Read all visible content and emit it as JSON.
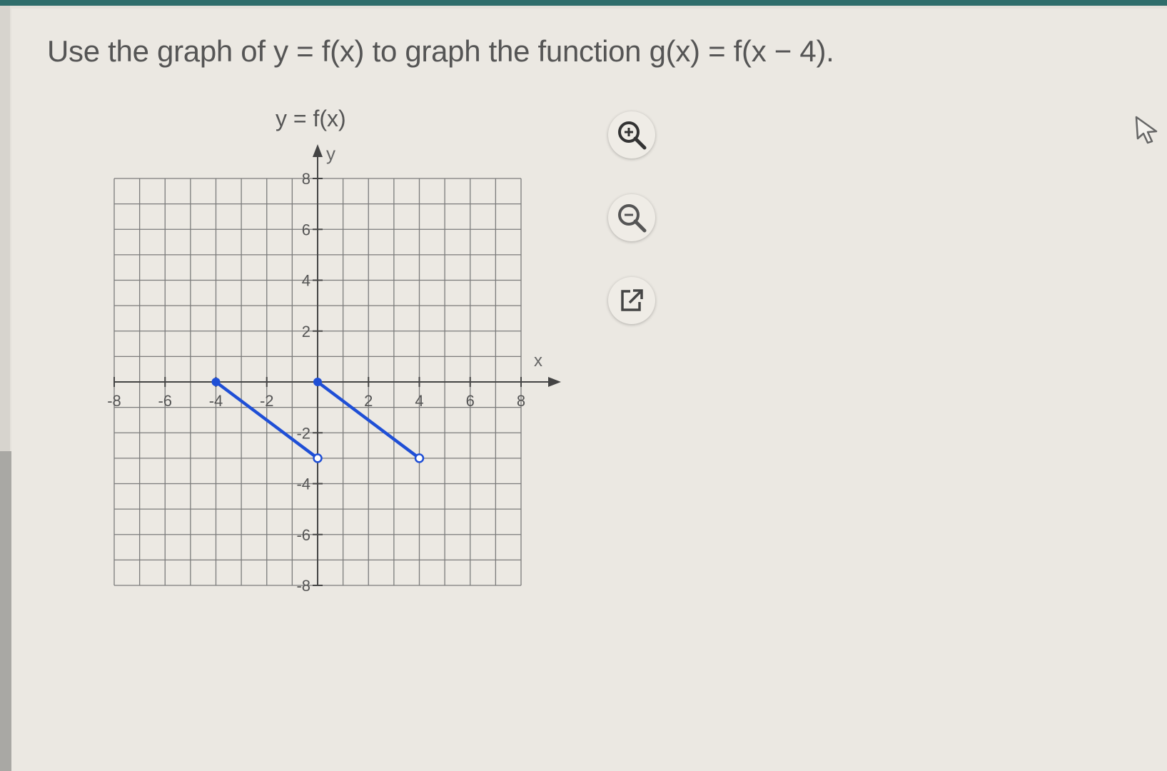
{
  "question": {
    "text": "Use the graph of y = f(x) to graph the function g(x) = f(x − 4)."
  },
  "toolbar": {
    "zoom_in_icon": "zoom-in-icon",
    "zoom_out_icon": "zoom-out-icon",
    "popout_icon": "external-link-icon"
  },
  "colors": {
    "line": "#1f4fd6",
    "grid": "#7b7b7b",
    "axis": "#444444",
    "top_bar": "#2f6d6b"
  },
  "chart_data": {
    "type": "line",
    "title": "y = f(x)",
    "xlabel": "x",
    "ylabel": "y",
    "xlim": [
      -8,
      8
    ],
    "ylim": [
      -8,
      8
    ],
    "grid": true,
    "x_ticks": [
      -8,
      -6,
      -4,
      -2,
      2,
      4,
      6,
      8
    ],
    "y_ticks": [
      8,
      6,
      4,
      2,
      -2,
      -4,
      -6,
      -8
    ],
    "segments": [
      {
        "x": [
          -4,
          0
        ],
        "y": [
          0,
          -3
        ],
        "closed_start": true,
        "open_end": true
      },
      {
        "x": [
          0,
          4
        ],
        "y": [
          0,
          -3
        ],
        "closed_start": true,
        "open_end": true
      }
    ]
  }
}
